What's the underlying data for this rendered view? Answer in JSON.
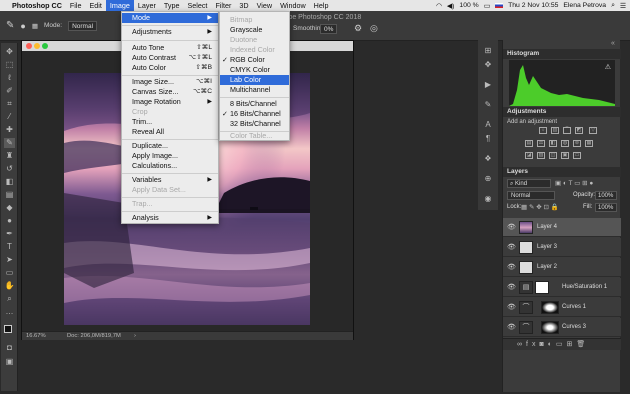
{
  "menubar": {
    "app_name": "Photoshop CC",
    "items": [
      "File",
      "Edit",
      "Image",
      "Layer",
      "Type",
      "Select",
      "Filter",
      "3D",
      "View",
      "Window",
      "Help"
    ],
    "active_item": "Image",
    "battery": "100 %",
    "datetime": "Thu 2 Nov  10:55",
    "user": "Elena Petrova"
  },
  "options_bar": {
    "mode_label": "Mode:",
    "mode_value": "Normal",
    "doc_title": "Adobe Photoshop CC 2018",
    "smoothing_label": "Smoothing:",
    "smoothing_value": "0%"
  },
  "image_menu": {
    "items": [
      {
        "label": "Mode",
        "arrow": "▶",
        "highlighted": true
      },
      {
        "label": "Adjustments",
        "arrow": "▶"
      },
      {
        "label": "Auto Tone",
        "shortcut": "⇧⌘L"
      },
      {
        "label": "Auto Contrast",
        "shortcut": "⌥⇧⌘L"
      },
      {
        "label": "Auto Color",
        "shortcut": "⇧⌘B"
      },
      {
        "label": "Image Size...",
        "shortcut": "⌥⌘I"
      },
      {
        "label": "Canvas Size...",
        "shortcut": "⌥⌘C"
      },
      {
        "label": "Image Rotation",
        "arrow": "▶"
      },
      {
        "label": "Crop",
        "disabled": true
      },
      {
        "label": "Trim..."
      },
      {
        "label": "Reveal All"
      },
      {
        "label": "Duplicate..."
      },
      {
        "label": "Apply Image..."
      },
      {
        "label": "Calculations..."
      },
      {
        "label": "Variables",
        "arrow": "▶"
      },
      {
        "label": "Apply Data Set...",
        "disabled": true
      },
      {
        "label": "Trap...",
        "disabled": true
      },
      {
        "label": "Analysis",
        "arrow": "▶"
      }
    ]
  },
  "mode_submenu": {
    "items": [
      {
        "label": "Bitmap",
        "disabled": true
      },
      {
        "label": "Grayscale"
      },
      {
        "label": "Duotone",
        "disabled": true
      },
      {
        "label": "Indexed Color",
        "disabled": true
      },
      {
        "label": "RGB Color",
        "check": "✓"
      },
      {
        "label": "CMYK Color"
      },
      {
        "label": "Lab Color",
        "highlighted": true
      },
      {
        "label": "Multichannel"
      },
      {
        "label": "8 Bits/Channel"
      },
      {
        "label": "16 Bits/Channel",
        "check": "✓"
      },
      {
        "label": "32 Bits/Channel"
      },
      {
        "label": "Color Table...",
        "disabled": true
      }
    ]
  },
  "document": {
    "zoom": "16.67%",
    "doc_size": "Doc: 206,0M/819,7M"
  },
  "histogram": {
    "title": "Histogram"
  },
  "adjustments": {
    "title": "Adjustments",
    "subtitle": "Add an adjustment"
  },
  "layers": {
    "title": "Layers",
    "kind_label": "Kind",
    "blend_mode": "Normal",
    "opacity_label": "Opacity:",
    "opacity_value": "100%",
    "lock_label": "Lock:",
    "fill_label": "Fill:",
    "fill_value": "100%",
    "rows": [
      {
        "name": "Layer 4",
        "selected": true
      },
      {
        "name": "Layer 3"
      },
      {
        "name": "Layer 2"
      },
      {
        "name": "Hue/Saturation 1"
      },
      {
        "name": "Curves 1"
      },
      {
        "name": "Curves 3"
      }
    ]
  },
  "colors": {
    "menu_highlight": "#2f6bd9",
    "histogram_fill": "#4ccc2a",
    "panel_bg": "#3b3b3b"
  }
}
